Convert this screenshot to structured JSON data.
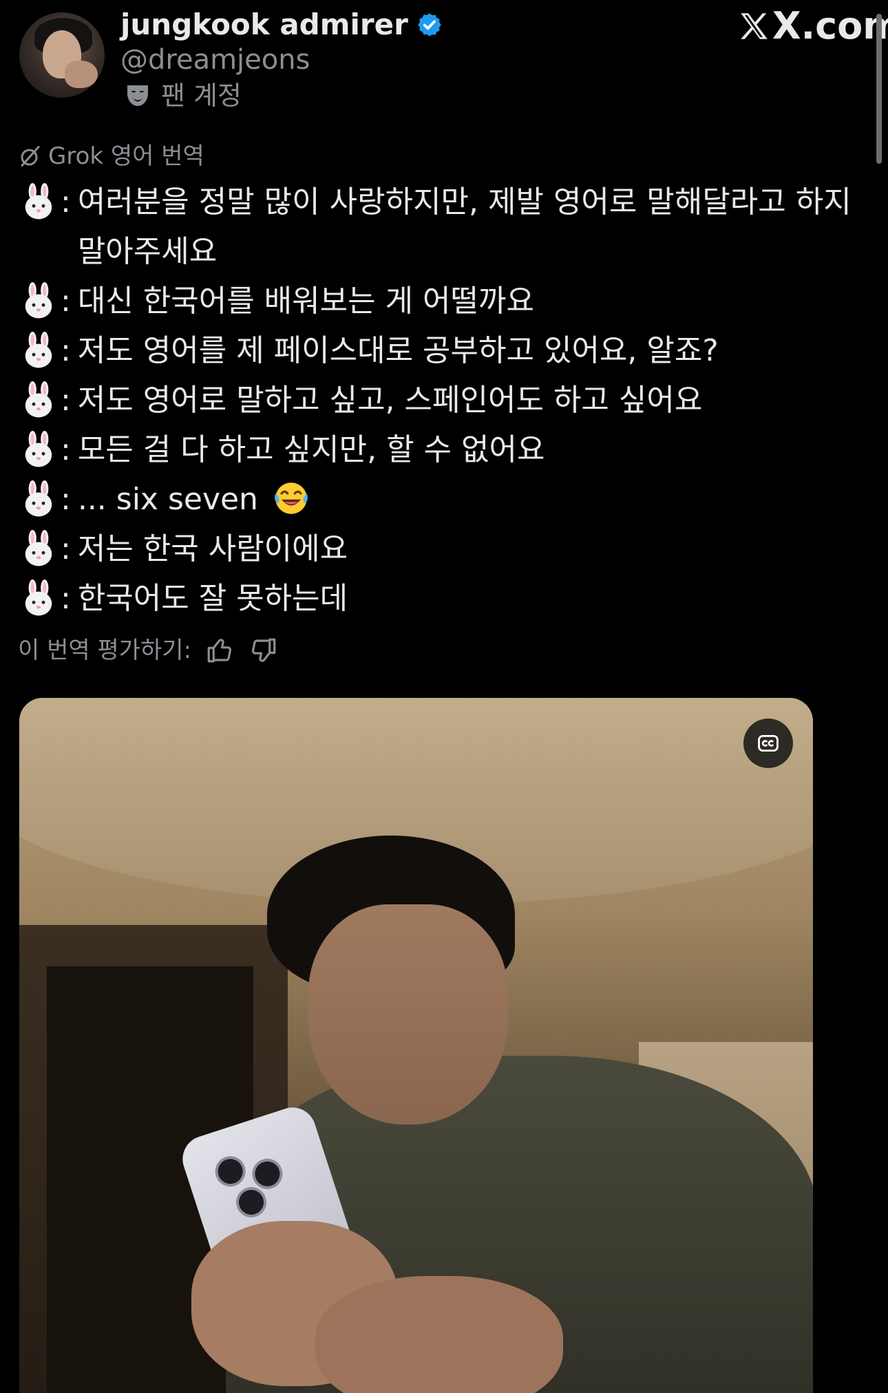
{
  "header": {
    "display_name": "jungkook admirer",
    "handle": "@dreamjeons",
    "fan_label": "팬 계정",
    "brand": "X.com",
    "colors": {
      "verified": "#1d9bf0",
      "text": "#e7e9ea",
      "muted": "#8b8f94"
    },
    "icons": [
      "verified-badge-icon",
      "theater-mask-icon",
      "x-logo-icon"
    ]
  },
  "translation": {
    "label": "Grok 영어 번역",
    "icon": "grok-icon",
    "speaker_icon": "rabbit-face-emoji",
    "lines": [
      "여러분을 정말 많이 사랑하지만, 제발 영어로 말해달라고 하지 말아주세요",
      "대신 한국어를 배워보는 게 어떨까요",
      "저도 영어를 제 페이스대로 공부하고 있어요, 알죠?",
      "저도 영어로 말하고 싶고, 스페인어도 하고 싶어요",
      "모든 걸 다 하고 싶지만, 할 수 없어요",
      "... six seven",
      "저는 한국 사람이에요",
      "한국어도 잘 못하는데"
    ],
    "line_6_emoji": "laughing-tears-emoji",
    "rate_label": "이 번역 평가하기:",
    "rate_icons": [
      "thumbs-up-icon",
      "thumbs-down-icon"
    ]
  },
  "media": {
    "type": "video",
    "cc_icon": "closed-captions-icon"
  }
}
